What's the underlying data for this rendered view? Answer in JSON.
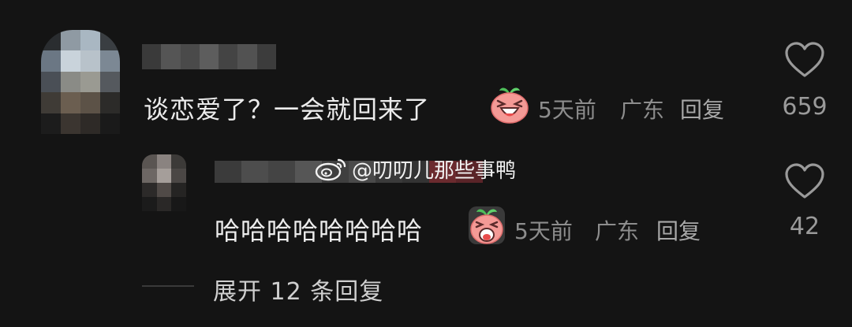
{
  "comment": {
    "text": "谈恋爱了？一会就回来了",
    "time": "5天前",
    "location": "广东",
    "reply_label": "回复",
    "like_count": "659",
    "emoji_icon": "laughing-sprout-face-icon"
  },
  "reply": {
    "text": "哈哈哈哈哈哈哈哈",
    "time": "5天前",
    "location": "广东",
    "reply_label": "回复",
    "like_count": "42",
    "emoji_icon": "screaming-laugh-sprout-face-icon"
  },
  "expand_replies": "展开 12 条回复",
  "watermark": "@叨叨儿那些事鸭",
  "colors": {
    "background": "#141414",
    "text": "#ececec",
    "meta": "#8d8d8d",
    "emoji_face": "#f28a8a",
    "emoji_leaf": "#4ebf5a"
  }
}
